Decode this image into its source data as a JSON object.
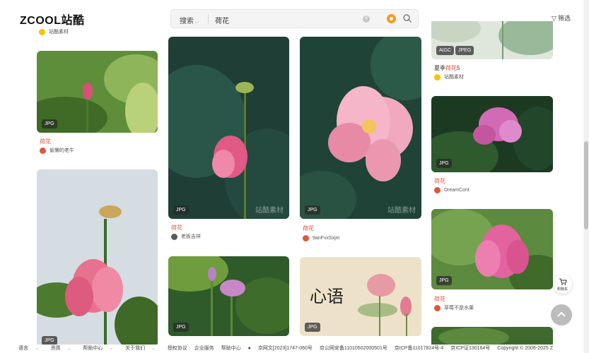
{
  "header": {
    "logo": "ZCOOL站酷",
    "search": {
      "scope": "搜索",
      "value": "荷花"
    },
    "filter_label": "筛选"
  },
  "cards": [
    {
      "id": "c1",
      "badge": "JPG",
      "title": "荷花",
      "author": "偷懒的老牛",
      "avatar_color": "#e0563b"
    },
    {
      "id": "c2",
      "badge": "JPG",
      "title": "荷花",
      "author": "老板吉祥",
      "avatar_color": "#5a5a5a",
      "watermark": "站酷素材"
    },
    {
      "id": "c3",
      "badge": "JPG",
      "title": "荷花",
      "author": "9anFvxSxjm",
      "avatar_color": "#e0563b",
      "watermark": "站酷素材"
    },
    {
      "id": "c4",
      "badges": [
        "AIGC",
        "JPEG"
      ],
      "title_plain": "夏季",
      "title_highlight": "荷花",
      "title_suffix": "5",
      "author": "站酷素材",
      "avatar_color": "#f5c400"
    },
    {
      "id": "c5",
      "badge": "JPG",
      "title": "荷花",
      "author": "DreamCont",
      "avatar_color": "#e0563b"
    },
    {
      "id": "c6",
      "badge": "JPG",
      "title": "荷花",
      "author": "草莓不是水果",
      "avatar_color": "#e0563b"
    },
    {
      "id": "c7",
      "badge": "JPG"
    },
    {
      "id": "c8",
      "badge": "JPG"
    },
    {
      "id": "c9",
      "badge": "JPG",
      "art_text": "心语"
    },
    {
      "id": "c10"
    }
  ],
  "top_partial_author": "站酷素材",
  "cart_label": "购物车",
  "footer": {
    "items": [
      "语言",
      "资质",
      "帮助中心",
      "关于我们"
    ],
    "links": [
      "授权协议",
      "企业服务",
      "帮助中心"
    ],
    "records": [
      "京网文[2023]1747-060号",
      "京公网安备11010502000501号",
      "京ICP备11017824号-4",
      "京ICP证130164号",
      "Copyright © 2006-2025 Z"
    ]
  },
  "colors": {
    "accent": "#e0553c",
    "brand": "#111111"
  }
}
